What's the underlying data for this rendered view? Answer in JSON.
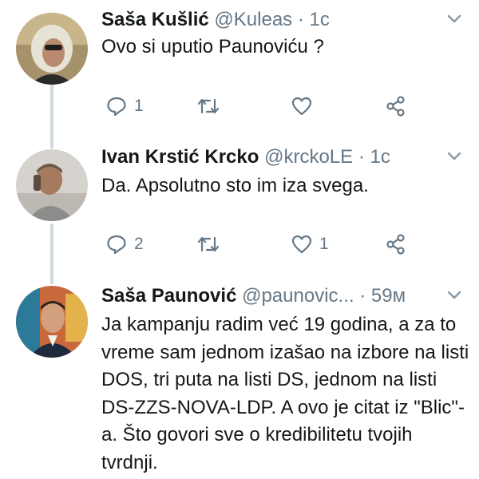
{
  "tweets": [
    {
      "name": "Saša Kušlić",
      "handle": "@Kuleas",
      "time": "1c",
      "text": "Ovo si uputio Paunoviću ?",
      "replies": "1",
      "retweets": "",
      "likes": ""
    },
    {
      "name": "Ivan Krstić Krcko",
      "handle": "@krckoLE",
      "time": "1c",
      "text": "Da. Apsolutno sto im iza svega.",
      "replies": "2",
      "retweets": "",
      "likes": "1"
    },
    {
      "name": "Saša Paunović",
      "handle": "@paunovic...",
      "time": "59м",
      "text": "Ja kampanju radim već 19 godina, a za to vreme sam jednom izašao na izbore na listi DOS, tri puta na listi DS, jednom na listi DS-ZZS-NOVA-LDP. A ovo je citat iz \"Blic\"-a. Što govori sve o kredibilitetu tvojih tvrdnji."
    }
  ],
  "icons": {
    "reply": "reply-icon",
    "retweet": "retweet-icon",
    "like": "heart-icon",
    "share": "share-icon",
    "more": "chevron-down-icon"
  },
  "colors": {
    "text": "#14171a",
    "secondary": "#657786",
    "thread_line": "#cfd9de"
  }
}
